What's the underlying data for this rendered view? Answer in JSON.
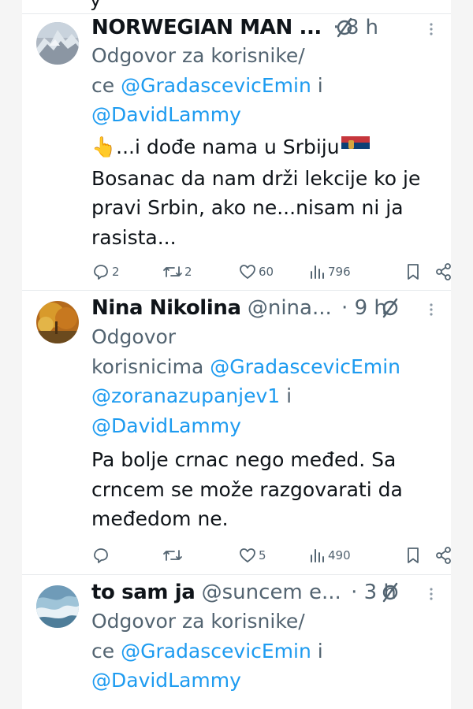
{
  "top_remnant": "y",
  "tweets": [
    {
      "name": "NORWEGIAN MAN ...",
      "handle": "",
      "time": "· 8 h",
      "reply_prefix": "Odgovor za korisnike/",
      "reply_prefix2": "ce",
      "mention1": "@GradascevicEmin",
      "conj": "i",
      "mention2": "@DavidLammy",
      "body_line1": "👆...i dođe nama u Srbiju",
      "body_line2": "Bosanac da nam drži lekcije ko je",
      "body_line3": "pravi Srbin, ako ne...nisam ni ja",
      "body_line4": "rasista...",
      "replies": "2",
      "reposts": "2",
      "likes": "60",
      "views": "796"
    },
    {
      "name": "Nina Nikolina",
      "handle": "@nina...",
      "time": "· 9 h",
      "reply_prefix": "Odgovor",
      "reply_prefix2": "korisnicima",
      "mention1": "@GradascevicEmin",
      "mention2": "@zoranazupanjev1",
      "conj": "i",
      "mention3": "@DavidLammy",
      "body_line1": "Pa bolje crnac nego međed. Sa",
      "body_line2": "crncem se može razgovarati da",
      "body_line3": "međedom ne.",
      "replies": "",
      "reposts": "",
      "likes": "5",
      "views": "490"
    },
    {
      "name": "to sam ja",
      "handle": "@suncem e...",
      "time": "· 3 h",
      "reply_prefix": "Odgovor za korisnike/",
      "reply_prefix2": "ce",
      "mention1": "@GradascevicEmin",
      "conj": "i",
      "mention2": "@DavidLammy"
    }
  ],
  "colors": {
    "accent": "#1d9bf0",
    "secondary": "#536471",
    "text": "#0f1419",
    "divider": "#e6e9ec"
  }
}
